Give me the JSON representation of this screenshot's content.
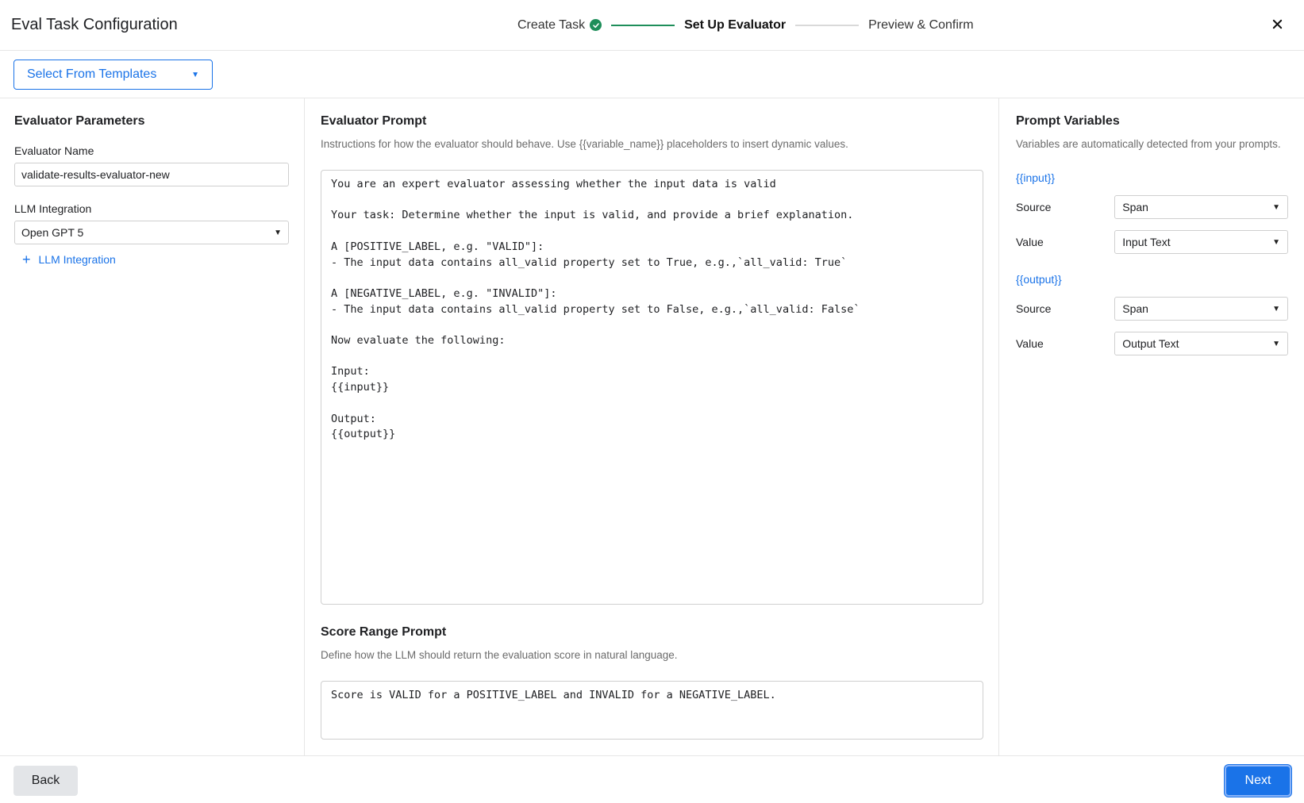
{
  "header": {
    "title": "Eval Task Configuration",
    "steps": [
      {
        "label": "Create Task",
        "state": "done"
      },
      {
        "label": "Set Up Evaluator",
        "state": "active"
      },
      {
        "label": "Preview & Confirm",
        "state": "todo"
      }
    ],
    "close_icon": "close-icon"
  },
  "templates": {
    "label": "Select From Templates"
  },
  "left": {
    "title": "Evaluator Parameters",
    "evaluator_name_label": "Evaluator Name",
    "evaluator_name_value": "validate-results-evaluator-new",
    "llm_integration_label": "LLM Integration",
    "llm_integration_value": "Open GPT 5",
    "add_integration_label": "LLM Integration"
  },
  "middle": {
    "prompt_title": "Evaluator Prompt",
    "prompt_desc": "Instructions for how the evaluator should behave. Use {{variable_name}} placeholders to insert dynamic values.",
    "prompt_text": "You are an expert evaluator assessing whether the input data is valid\n\nYour task: Determine whether the input is valid, and provide a brief explanation.\n\nA [POSITIVE_LABEL, e.g. \"VALID\"]:\n- The input data contains all_valid property set to True, e.g.,`all_valid: True`\n\nA [NEGATIVE_LABEL, e.g. \"INVALID\"]:\n- The input data contains all_valid property set to False, e.g.,`all_valid: False`\n\nNow evaluate the following:\n\nInput:\n{{input}}\n\nOutput:\n{{output}}",
    "score_title": "Score Range Prompt",
    "score_desc": "Define how the LLM should return the evaluation score in natural language.",
    "score_text": "Score is VALID for a POSITIVE_LABEL and INVALID for a NEGATIVE_LABEL."
  },
  "right": {
    "title": "Prompt Variables",
    "desc": "Variables are automatically detected from your prompts.",
    "variables": [
      {
        "name": "{{input}}",
        "source_label": "Source",
        "source_value": "Span",
        "value_label": "Value",
        "value_value": "Input Text"
      },
      {
        "name": "{{output}}",
        "source_label": "Source",
        "source_value": "Span",
        "value_label": "Value",
        "value_value": "Output Text"
      }
    ]
  },
  "footer": {
    "back_label": "Back",
    "next_label": "Next"
  },
  "colors": {
    "accent": "#1a73e8",
    "success": "#1e8e5a"
  }
}
